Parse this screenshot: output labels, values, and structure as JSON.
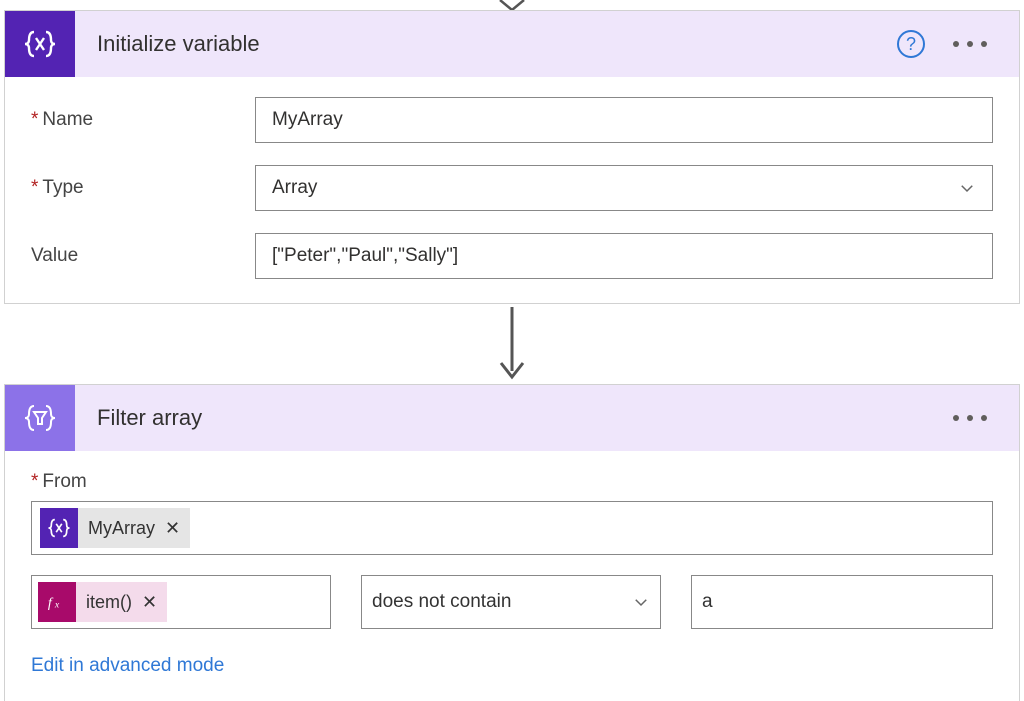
{
  "connector_top": true,
  "card1": {
    "title": "Initialize variable",
    "help": "?",
    "fields": {
      "name_label": "Name",
      "name_value": "MyArray",
      "type_label": "Type",
      "type_value": "Array",
      "value_label": "Value",
      "value_value": "[\"Peter\",\"Paul\",\"Sally\"]"
    }
  },
  "card2": {
    "title": "Filter array",
    "from_label": "From",
    "token_variable": "MyArray",
    "filter": {
      "left_token": "item()",
      "operator": "does not contain",
      "right_value": "a"
    },
    "advanced_link": "Edit in advanced mode"
  }
}
